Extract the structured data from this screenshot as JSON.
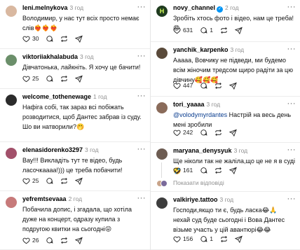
{
  "left": [
    {
      "username": "leni.melnykova",
      "time": "3 год",
      "verified": false,
      "text": "Володимир, у нас тут всіх просто немає слів",
      "emoji": "❤️‍🔥❤️‍🔥❤️‍🔥",
      "likes": "30",
      "comments": "",
      "reposts": "",
      "avatar_color": "#d9b8a0"
    },
    {
      "username": "viktoriiakhalabuda",
      "time": "3 год",
      "verified": false,
      "text": "Дівчатонька, лайкніть. Я хочу це бачити!",
      "likes": "25",
      "comments": "",
      "reposts": "",
      "avatar_color": "#6b8f6a"
    },
    {
      "username": "welcome_tothenewage",
      "time": "1 год",
      "verified": false,
      "text": "Нафіга собі, так зараз всі побіжать розводитися, щоб Дантес забрав із суду. Шо ви натворили?🤭",
      "likes": "",
      "comments": "",
      "reposts": "",
      "avatar_color": "#2b2b2b"
    },
    {
      "username": "elenasidorenko3297",
      "time": "3 год",
      "verified": false,
      "text": "Вау!!! Викладіть тут те відео, будь ласочкаааа!))) це треба побачити!",
      "likes": "25",
      "comments": "",
      "reposts": "",
      "avatar_color": "#a2506a"
    },
    {
      "username": "yefremtsevaaa",
      "time": "2 год",
      "verified": false,
      "text": "Побачила допис, і згадала, що хотіла дуже на концерт, одразу купила з подругою квитки на сьогодні😜",
      "likes": "26",
      "comments": "",
      "reposts": "",
      "avatar_color": "#c77a7a"
    }
  ],
  "right": [
    {
      "username": "novy_channel",
      "time": "2 год",
      "verified": true,
      "text": "Зробіть хтось фото і відео, нам це треба! 😍",
      "likes": "631",
      "comments": "1",
      "reposts": "",
      "avatar_color": "#1e1e1e"
    },
    {
      "username": "yanchik_karpenko",
      "time": "3 год",
      "verified": false,
      "text": "Ааааа, Вовчику не підведи, ми будемо всім жіночим тредсом щиро радіти за цю дівчину",
      "emoji": "🥰🥰🥰",
      "likes": "447",
      "comments": "",
      "reposts": "",
      "avatar_color": "#5a4a3a"
    },
    {
      "username": "tori_yaaaa",
      "time": "3 год",
      "verified": false,
      "mention": "@volodymyrdantes",
      "text": " Настрій на весь день мені зробили",
      "likes": "242",
      "comments": "",
      "reposts": "",
      "avatar_color": "#8a6b5a"
    },
    {
      "username": "maryana_denysyuk",
      "time": "3 год",
      "verified": false,
      "text": "Ще ніколи так не жаліла,що це не я в суді🤣",
      "likes": "161",
      "comments": "",
      "reposts": "",
      "avatar_color": "#6d5c52",
      "hidden_replies": "Показати відповіді"
    },
    {
      "username": "valkiriye.tattoo",
      "time": "3 год",
      "verified": false,
      "text": "Господи,якщо ти є, будь ласка😂🙏 нехай суд буде сьогодні і Вова Дантес візьме участь у цій авантюрі😂😂",
      "likes": "156",
      "comments": "1",
      "reposts": "",
      "avatar_color": "#3d3d3d"
    }
  ],
  "icons": {
    "like": "heart-icon",
    "comment": "comment-icon",
    "repost": "repost-icon",
    "share": "share-icon",
    "more": "more-icon"
  },
  "colors": {
    "verified": "#0095f6",
    "mention": "#0a3d8f",
    "muted": "#8e8e8e"
  }
}
